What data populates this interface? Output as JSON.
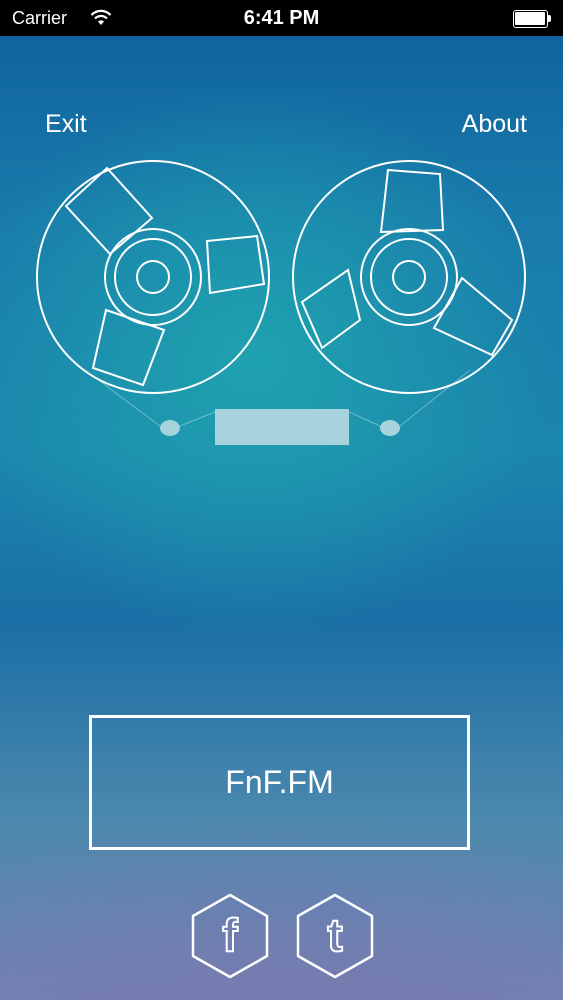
{
  "status_bar": {
    "carrier": "Carrier",
    "time": "6:41 PM"
  },
  "nav": {
    "exit_label": "Exit",
    "about_label": "About"
  },
  "player": {
    "station_label": "FnF.FM"
  },
  "social": {
    "facebook_glyph": "f",
    "tumblr_glyph": "t"
  },
  "colors": {
    "accent": "#ffffff",
    "tape_window": "#a6d3dc",
    "background_top": "#0e5f9c",
    "background_mid": "#20a8b0",
    "background_bottom": "#7384b3"
  },
  "icons": [
    "wifi-icon",
    "battery-icon",
    "tape-reel-icon",
    "facebook-icon",
    "tumblr-icon"
  ]
}
